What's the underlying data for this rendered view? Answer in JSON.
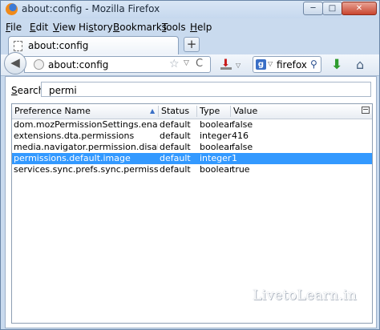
{
  "window": {
    "title": "about:config - Mozilla Firefox"
  },
  "window_controls": {
    "minimize": "─",
    "maximize": "□",
    "close": "✕"
  },
  "menu": [
    {
      "pre": "",
      "u": "F",
      "post": "ile"
    },
    {
      "pre": "",
      "u": "E",
      "post": "dit"
    },
    {
      "pre": "",
      "u": "V",
      "post": "iew"
    },
    {
      "pre": "Hi",
      "u": "s",
      "post": "tory"
    },
    {
      "pre": "",
      "u": "B",
      "post": "ookmarks"
    },
    {
      "pre": "",
      "u": "T",
      "post": "ools"
    },
    {
      "pre": "",
      "u": "H",
      "post": "elp"
    }
  ],
  "tabs": [
    {
      "label": "about:config"
    }
  ],
  "new_tab": "+",
  "nav": {
    "url": "about:config",
    "search_engine": "g",
    "search_text": "firefox",
    "back": "◀",
    "star": "☆",
    "dropdown": "▽",
    "reload": "C",
    "magnifier": "⚲",
    "download_arrow": "⬇",
    "home": "⌂"
  },
  "filter": {
    "label_u": "S",
    "label_rest": "earch:",
    "value": "permi"
  },
  "table": {
    "columns": [
      "Preference Name",
      "Status",
      "Type",
      "Value"
    ],
    "sort_indicator": "▲",
    "rows": [
      {
        "name": "dom.mozPermissionSettings.enabled",
        "status": "default",
        "type": "boolean",
        "value": "false",
        "selected": false
      },
      {
        "name": "extensions.dta.permissions",
        "status": "default",
        "type": "integer",
        "value": "416",
        "selected": false
      },
      {
        "name": "media.navigator.permission.disabled",
        "status": "default",
        "type": "boolean",
        "value": "false",
        "selected": false
      },
      {
        "name": "permissions.default.image",
        "status": "default",
        "type": "integer",
        "value": "1",
        "selected": true
      },
      {
        "name": "services.sync.prefs.sync.permissions.d...",
        "status": "default",
        "type": "boolean",
        "value": "true",
        "selected": false
      }
    ]
  },
  "watermark": "LivetoLearn.in",
  "colors": {
    "selection": "#3399ff",
    "chrome": "#c9daee"
  }
}
